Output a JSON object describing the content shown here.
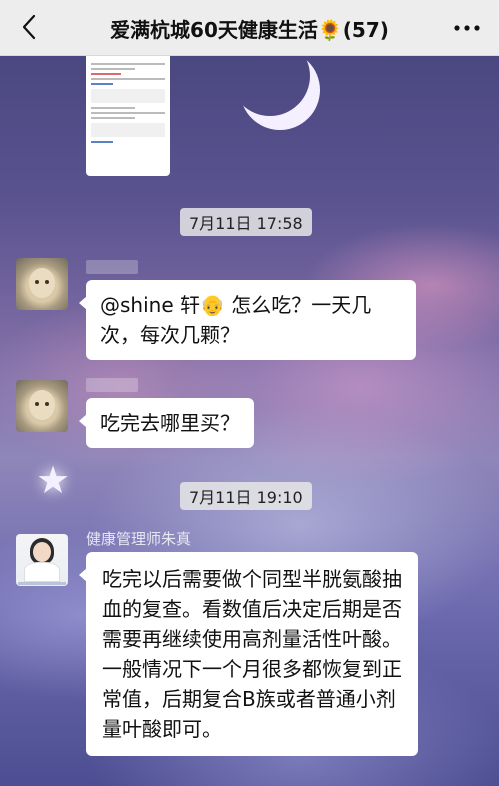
{
  "header": {
    "title": "爱满杭城60天健康生活🌻(57)",
    "back_icon": "chevron-left-icon",
    "more_icon": "more-horizontal-icon"
  },
  "timestamps": [
    "7月11日 17:58",
    "7月11日 19:10"
  ],
  "messages": [
    {
      "sender": "",
      "text": "@shine 轩👴 怎么吃？一天几次，每次几颗？"
    },
    {
      "sender": "",
      "text": "吃完去哪里买？"
    },
    {
      "sender": "健康管理师朱真",
      "text": "吃完以后需要做个同型半胱氨酸抽血的复查。看数值后决定后期是否需要再继续使用高剂量活性叶酸。一般情况下一个月很多都恢复到正常值，后期复合B族或者普通小剂量叶酸即可。"
    }
  ],
  "colors": {
    "header_bg": "#ededed",
    "bubble_bg": "#ffffff",
    "timestamp_bg": "#e6e6e6"
  }
}
